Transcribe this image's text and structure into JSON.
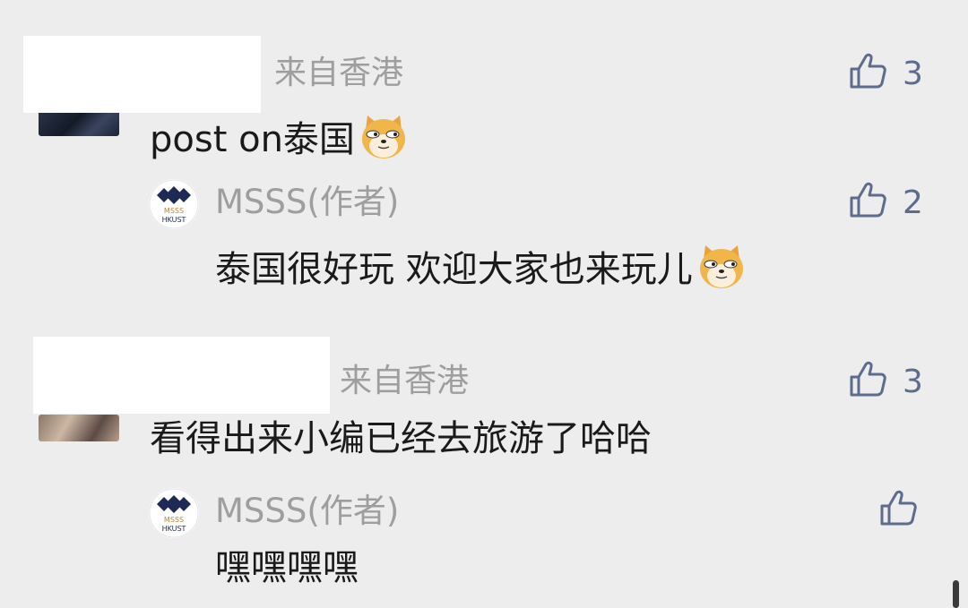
{
  "comments": [
    {
      "location": "来自香港",
      "text": "post on泰国",
      "emoji": "doge-emoji",
      "likes": "3",
      "reply": {
        "author": "MSSS(作者)",
        "avatar_text_top": "MSSS",
        "avatar_text_bottom": "HKUST",
        "text": "泰国很好玩 欢迎大家也来玩儿",
        "emoji": "doge-emoji",
        "likes": "2"
      }
    },
    {
      "location": "来自香港",
      "text": "看得出来小编已经去旅游了哈哈",
      "likes": "3",
      "reply": {
        "author": "MSSS(作者)",
        "avatar_text_top": "MSSS",
        "avatar_text_bottom": "HKUST",
        "text": "嘿嘿嘿嘿",
        "likes": ""
      }
    }
  ],
  "colors": {
    "background": "#ededed",
    "secondary_text": "#9e9e9e",
    "like_icon": "#5d6c8c",
    "logo_navy": "#1c2a55",
    "logo_gold": "#b08a3a"
  },
  "icons": {
    "like": "thumbs-up-icon",
    "emoji": "doge-emoji"
  }
}
